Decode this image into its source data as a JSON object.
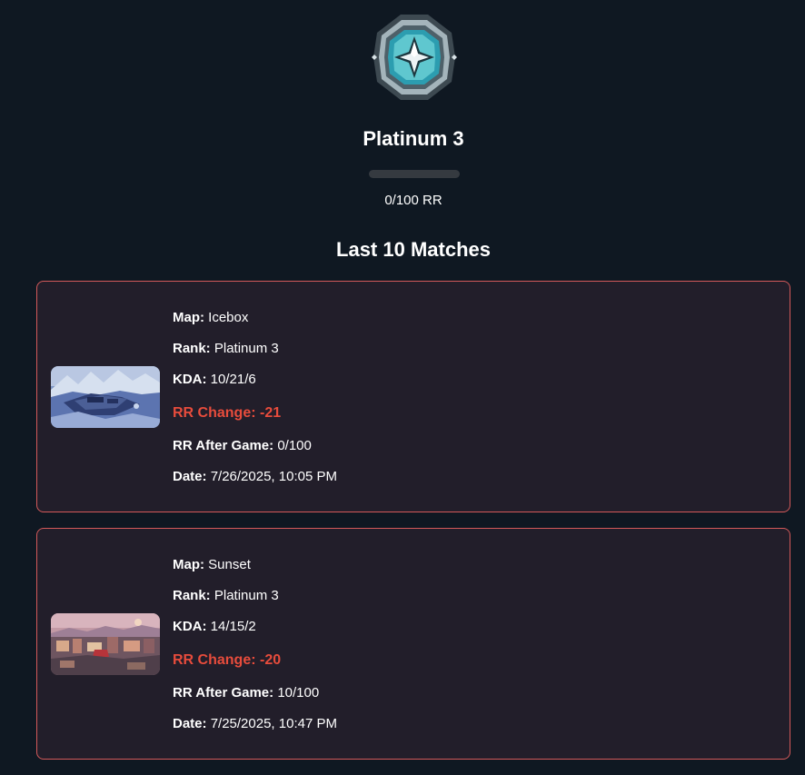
{
  "rank": {
    "icon": "platinum-rank-icon",
    "name": "Platinum 3",
    "rr_current": 0,
    "rr_max": 100,
    "progress_fraction": 0,
    "rr_text": "0/100 RR"
  },
  "matches_section": {
    "title": "Last 10 Matches"
  },
  "labels": {
    "map": "Map:",
    "rank": "Rank:",
    "kda": "KDA:",
    "rr_change": "RR Change:",
    "rr_after": "RR After Game:",
    "date": "Date:"
  },
  "matches": [
    {
      "map": "Icebox",
      "map_image": "icebox-map-thumbnail",
      "rank": "Platinum 3",
      "kda": "10/21/6",
      "rr_change": "-21",
      "rr_after": "0/100",
      "date": "7/26/2025, 10:05 PM"
    },
    {
      "map": "Sunset",
      "map_image": "sunset-map-thumbnail",
      "rank": "Platinum 3",
      "kda": "14/15/2",
      "rr_change": "-20",
      "rr_after": "10/100",
      "date": "7/25/2025, 10:47 PM"
    }
  ],
  "colors": {
    "background": "#0f1822",
    "card_background": "#221e2a",
    "card_border": "#d3595a",
    "rr_negative": "#e74c3c",
    "progress_track": "#353a40",
    "platinum_accent": "#5fc7cf"
  }
}
